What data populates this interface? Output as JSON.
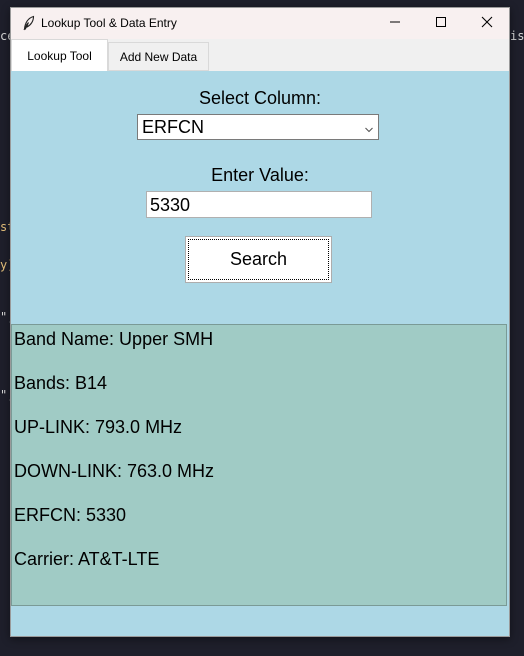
{
  "window": {
    "title": "Lookup Tool & Data Entry"
  },
  "background_fragments": [
    {
      "text": "ce",
      "color": "#d4d4d4"
    },
    {
      "text": "is",
      "color": "#d4d4d4"
    },
    {
      "text": "st",
      "color": "#e5c07b"
    },
    {
      "text": "y)",
      "color": "#e5c07b"
    },
    {
      "text": "\",",
      "color": "#d4d4d4"
    },
    {
      "text": "\",",
      "color": "#d4d4d4"
    }
  ],
  "tabs": [
    {
      "label": "Lookup Tool",
      "active": true
    },
    {
      "label": "Add New Data",
      "active": false
    }
  ],
  "form": {
    "select_column_label": "Select Column:",
    "selected_column": "ERFCN",
    "enter_value_label": "Enter Value:",
    "value": "5330",
    "search_label": "Search"
  },
  "results": [
    "Band Name: Upper SMH",
    "Bands: B14",
    "UP-LINK: 793.0 MHz",
    "DOWN-LINK: 763.0 MHz",
    "ERFCN: 5330",
    "Carrier: AT&T-LTE"
  ],
  "colors": {
    "content_bg": "#add8e6",
    "results_bg": "#a0cbc5",
    "titlebar_bg": "#f8f0f0"
  },
  "icons": {
    "app": "feather-icon",
    "minimize": "minimize-icon",
    "maximize": "maximize-icon",
    "close": "close-icon",
    "dropdown": "chevron-down-icon"
  }
}
